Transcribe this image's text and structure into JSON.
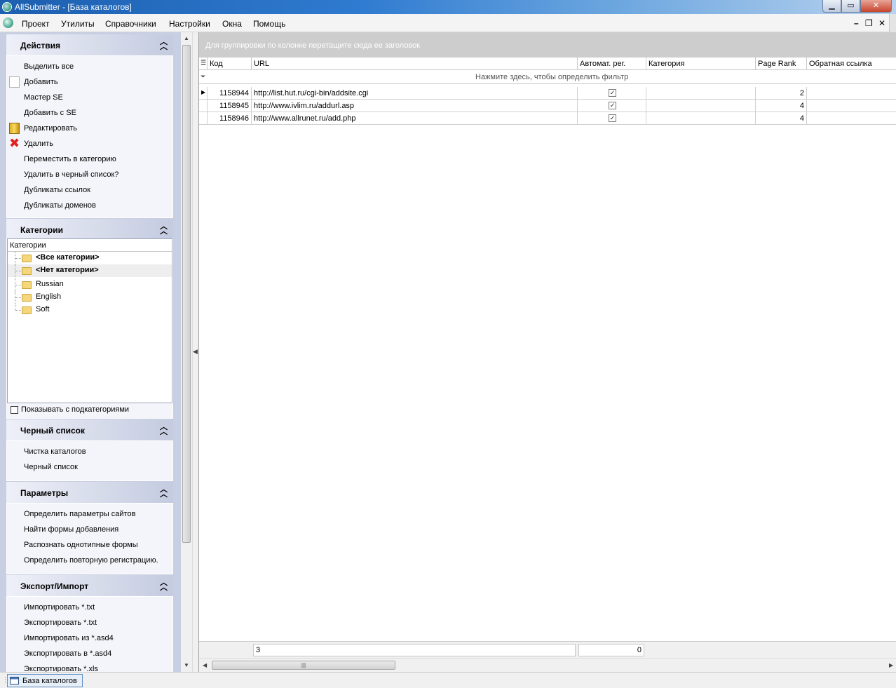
{
  "window": {
    "title": "AllSubmitter - [База каталогов]",
    "min": "▁",
    "max": "▭",
    "close": "✕"
  },
  "menu": {
    "items": [
      "Проект",
      "Утилиты",
      "Справочники",
      "Настройки",
      "Окна",
      "Помощь"
    ],
    "mdi_min": "–",
    "mdi_restore": "❐",
    "mdi_close": "✕"
  },
  "actions": {
    "title": "Действия",
    "items": [
      "Выделить все",
      "Добавить",
      "Мастер SE",
      "Добавить с SE",
      "Редактировать",
      "Удалить",
      "Переместить в категорию",
      "Удалить в черный список?",
      "Дубликаты ссылок",
      "Дубликаты доменов"
    ]
  },
  "categories": {
    "title": "Категории",
    "tree_header": "Категории",
    "items": [
      "<Все категории>",
      "<Нет категории>",
      "Russian",
      "English",
      "Soft"
    ],
    "show_sub_label": "Показывать с подкатегориями"
  },
  "blacklist": {
    "title": "Черный список",
    "items": [
      "Чистка каталогов",
      "Черный список"
    ]
  },
  "params": {
    "title": "Параметры",
    "items": [
      "Определить параметры сайтов",
      "Найти формы добавления",
      "Распознать однотипные формы",
      "Определить повторную регистрацию."
    ]
  },
  "export": {
    "title": "Экспорт/Импорт",
    "items": [
      "Импортировать *.txt",
      "Экспортировать *.txt",
      "Импортировать из *.asd4",
      "Экспортировать в *.asd4",
      "Экспортировать *.xls"
    ]
  },
  "grid": {
    "group_hint": "Для группировки по колонке перетащите сюда ее заголовок",
    "filter_hint": "Нажмите здесь, чтобы определить фильтр",
    "columns": [
      "Код",
      "URL",
      "Автомат. рег.",
      "Категория",
      "Page Rank",
      "Обратная ссылка"
    ],
    "rows": [
      {
        "code": "1158944",
        "url": "http://list.hut.ru/cgi-bin/addsite.cgi",
        "auto": true,
        "category": "",
        "pr": "2",
        "backlink": ""
      },
      {
        "code": "1158945",
        "url": "http://www.ivlim.ru/addurl.asp",
        "auto": true,
        "category": "",
        "pr": "4",
        "backlink": ""
      },
      {
        "code": "1158946",
        "url": "http://www.allrunet.ru/add.php",
        "auto": true,
        "category": "",
        "pr": "4",
        "backlink": ""
      }
    ],
    "footer_count": "3",
    "footer_sum": "0"
  },
  "status": {
    "tab_label": "База каталогов"
  }
}
